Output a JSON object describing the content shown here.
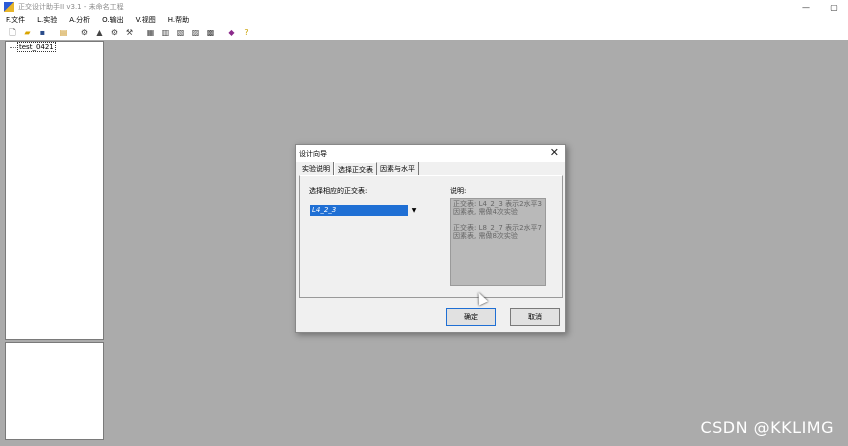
{
  "window": {
    "title": "正交设计助手II v3.1 - 未命名工程",
    "minimize": "—",
    "maximize": "▢"
  },
  "menu": [
    "F.文件",
    "L.实验",
    "A.分析",
    "O.输出",
    "V.视图",
    "H.帮助"
  ],
  "tree": {
    "item": "test_0421"
  },
  "dialog": {
    "title": "设计向导",
    "close": "✕",
    "tabs": [
      "实验说明",
      "选择正交表",
      "因素与水平"
    ],
    "select_label": "选择相应的正交表:",
    "selected_value": "L4_2_3",
    "desc_label": "说明:",
    "desc_lines": [
      "正交表: L4_2_3 表示2水平3因素表, 需做4次实验",
      "正交表: L8_2_7 表示2水平7因素表, 需做8次实验"
    ],
    "ok": "确定",
    "cancel": "取消"
  },
  "watermark": "CSDN @KKLIMG"
}
